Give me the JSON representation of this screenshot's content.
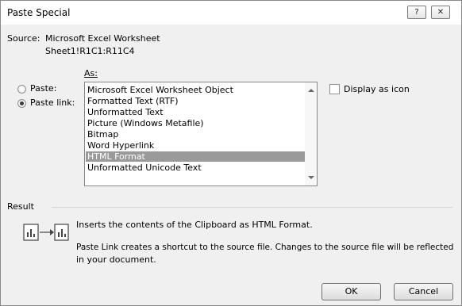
{
  "dialog": {
    "title": "Paste Special",
    "help_glyph": "?",
    "close_glyph": "✕"
  },
  "source": {
    "label": "Source:",
    "name": "Microsoft Excel Worksheet",
    "range": "Sheet1!R1C1:R11C4"
  },
  "as_label": "As:",
  "options": {
    "paste_label": "Paste:",
    "paste_link_label": "Paste link:",
    "selected": "paste_link"
  },
  "list": {
    "items": [
      "Microsoft Excel Worksheet Object",
      "Formatted Text (RTF)",
      "Unformatted Text",
      "Picture (Windows Metafile)",
      "Bitmap",
      "Word Hyperlink",
      "HTML Format",
      "Unformatted Unicode Text"
    ],
    "selected_index": 6
  },
  "display_as_icon": {
    "label": "Display as icon",
    "checked": false
  },
  "result": {
    "label": "Result",
    "line1": "Inserts the contents of the Clipboard as HTML Format.",
    "line2a": "Paste Link creates a shortcut to the source file. Changes to the source file will be reflected",
    "line2b": "in your document."
  },
  "buttons": {
    "ok": "OK",
    "cancel": "Cancel"
  },
  "icons": {
    "help": "help-icon",
    "close": "close-icon",
    "result": "paste-link-icon"
  }
}
